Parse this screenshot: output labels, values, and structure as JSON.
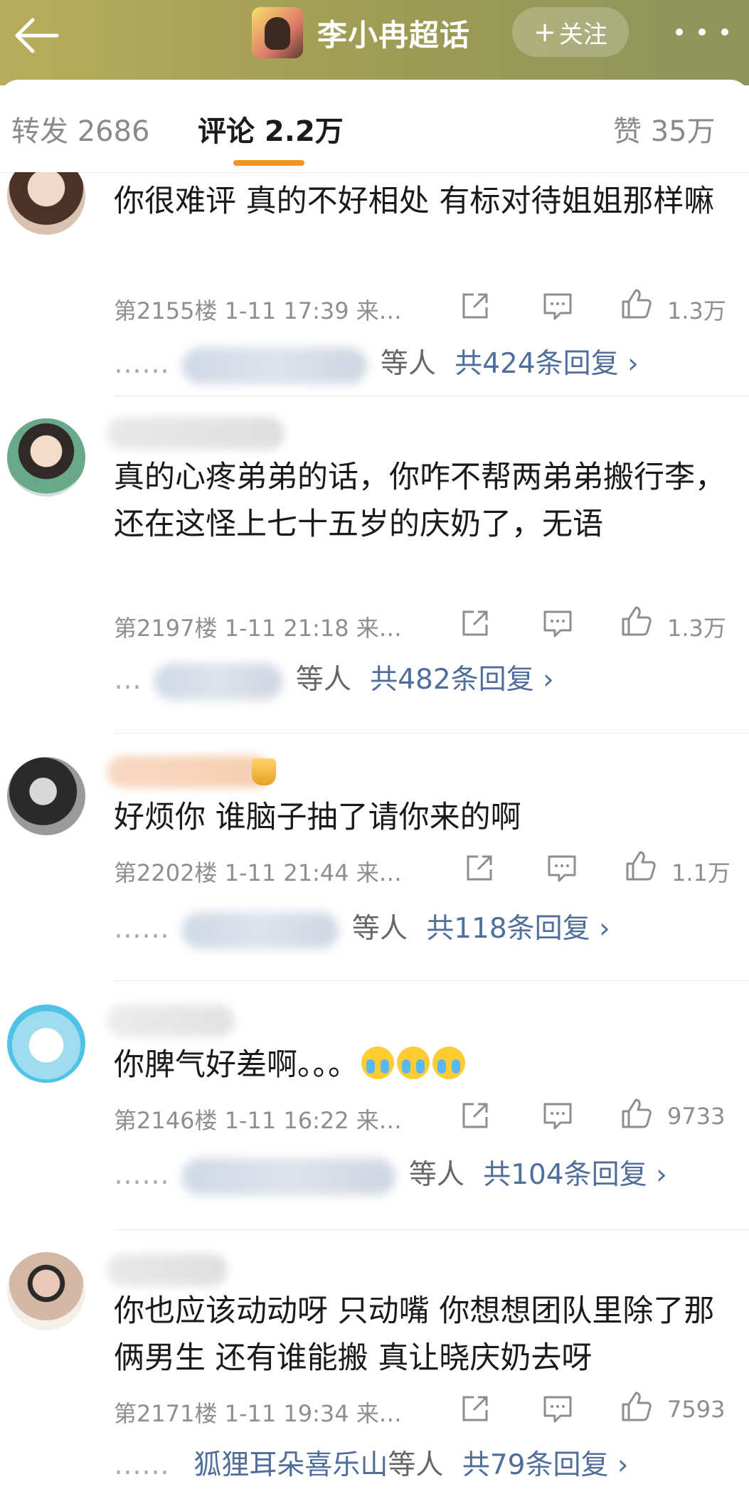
{
  "header": {
    "title": "李小冉超话",
    "follow_label": "关注",
    "follow_plus": "+"
  },
  "tabs": [
    {
      "label": "转发 2686"
    },
    {
      "label": "评论 2.2万"
    },
    {
      "label": "赞 35万"
    }
  ],
  "colors": {
    "accent": "#f7931e",
    "link": "#4f6e99",
    "header_bg": "#9c9b55"
  },
  "comments": [
    {
      "text": "你很难评 真的不好相处 有标对待姐姐那样嘛",
      "meta": "第2155楼 1-11 17:39  来…",
      "likes": "1.3万",
      "reply_prefix": "……",
      "reply_etc": "等人",
      "reply_count": "共424条回复 ›"
    },
    {
      "text": "真的心疼弟弟的话，你咋不帮两弟弟搬行李，还在这怪上七十五岁的庆奶了，无语",
      "meta": "第2197楼 1-11 21:18  来…",
      "likes": "1.3万",
      "reply_prefix": "…",
      "reply_etc": "等人",
      "reply_count": "共482条回复 ›"
    },
    {
      "text": "好烦你 谁脑子抽了请你来的啊",
      "meta": "第2202楼 1-11 21:44  来…",
      "likes": "1.1万",
      "reply_prefix": "……",
      "reply_etc": "等人",
      "reply_count": "共118条回复 ›"
    },
    {
      "text": "你脾气好差啊。。。",
      "meta": "第2146楼 1-11 16:22  来…",
      "likes": "9733",
      "reply_prefix": "……",
      "reply_etc": "等人",
      "reply_count": "共104条回复 ›"
    },
    {
      "text": "你也应该动动呀 只动嘴 你想想团队里除了那俩男生 还有谁能搬 真让晓庆奶去呀",
      "meta": "第2171楼 1-11 19:34  来…",
      "likes": "7593",
      "reply_prefix": "……",
      "reply_name": "狐狸耳朵喜乐山",
      "reply_etc": "等人",
      "reply_count": "共79条回复 ›"
    }
  ]
}
